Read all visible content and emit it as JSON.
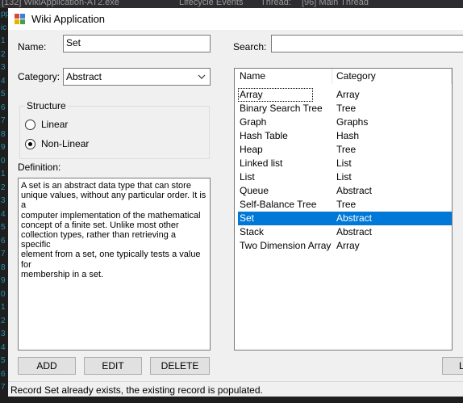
{
  "ide": {
    "tab_text": "[132] WikiApplication-AT2.exe",
    "lifecycle_text": "Lifecycle Events",
    "thread_label": "Thread:",
    "thread_value": "[96] Main Thread",
    "gutter": [
      "pp",
      "ic",
      "1",
      "2",
      "3",
      "4",
      "5",
      "6",
      "7",
      "8",
      "9",
      "0",
      "1",
      "2",
      "3",
      "4",
      "5",
      "6",
      "7",
      "8",
      "9",
      "0",
      "1",
      "2",
      "3",
      "4",
      "5",
      "6",
      "7"
    ]
  },
  "window": {
    "title": "Wiki Application"
  },
  "form": {
    "name_label": "Name:",
    "name_value": "Set",
    "category_label": "Category:",
    "category_value": "Abstract",
    "structure_legend": "Structure",
    "structure_options": [
      {
        "label": "Linear",
        "checked": false
      },
      {
        "label": "Non-Linear",
        "checked": true
      }
    ],
    "definition_label": "Definition:",
    "definition_text": "A set is an abstract data type that can store\nunique values, without any particular order. It is a\ncomputer implementation of the mathematical\nconcept of a finite set. Unlike most other\ncollection types, rather than retrieving a specific\nelement from a set, one typically tests a value for\nmembership in a set."
  },
  "buttons": {
    "add": "ADD",
    "edit": "EDIT",
    "delete": "DELETE",
    "right_partial": "L"
  },
  "search": {
    "label": "Search:",
    "value": ""
  },
  "list": {
    "columns": [
      "Name",
      "Category"
    ],
    "rows": [
      {
        "name": "Array",
        "category": "Array",
        "state": "focused"
      },
      {
        "name": "Binary Search Tree",
        "category": "Tree",
        "state": ""
      },
      {
        "name": "Graph",
        "category": "Graphs",
        "state": ""
      },
      {
        "name": "Hash Table",
        "category": "Hash",
        "state": ""
      },
      {
        "name": "Heap",
        "category": "Tree",
        "state": ""
      },
      {
        "name": "Linked list",
        "category": "List",
        "state": ""
      },
      {
        "name": "List",
        "category": "List",
        "state": ""
      },
      {
        "name": "Queue",
        "category": "Abstract",
        "state": ""
      },
      {
        "name": "Self-Balance Tree",
        "category": "Tree",
        "state": ""
      },
      {
        "name": "Set",
        "category": "Abstract",
        "state": "selected"
      },
      {
        "name": "Stack",
        "category": "Abstract",
        "state": ""
      },
      {
        "name": "Two Dimension Array",
        "category": "Array",
        "state": ""
      }
    ]
  },
  "status": {
    "text": "Record Set already exists, the existing record is populated."
  },
  "colors": {
    "selection": "#0078d7",
    "window_bg": "#f0f0f0",
    "ide_bg": "#1e1e1e"
  }
}
